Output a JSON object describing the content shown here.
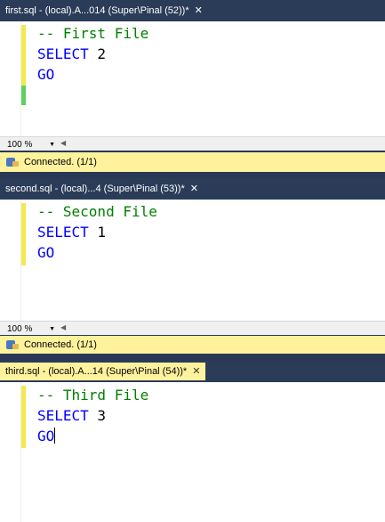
{
  "windows": [
    {
      "tab_title": "first.sql - (local).A...014 (Super\\Pinal (52))*",
      "close_glyph": "✕",
      "active": false,
      "lines": [
        {
          "parts": [
            {
              "t": "-- First File",
              "c": "cmt"
            }
          ]
        },
        {
          "parts": [
            {
              "t": "SELECT",
              "c": "kw"
            },
            {
              "t": " 2",
              "c": "num"
            }
          ]
        },
        {
          "parts": [
            {
              "t": "GO",
              "c": "kw"
            }
          ]
        }
      ],
      "zoom": "100 %",
      "status": "Connected. (1/1)"
    },
    {
      "tab_title": "second.sql - (local)...4 (Super\\Pinal (53))*",
      "close_glyph": "✕",
      "active": false,
      "lines": [
        {
          "parts": [
            {
              "t": "-- Second File",
              "c": "cmt"
            }
          ]
        },
        {
          "parts": [
            {
              "t": "SELECT",
              "c": "kw"
            },
            {
              "t": " 1",
              "c": "num"
            }
          ]
        },
        {
          "parts": [
            {
              "t": "GO",
              "c": "kw"
            }
          ]
        }
      ],
      "zoom": "100 %",
      "status": "Connected. (1/1)"
    },
    {
      "tab_title": "third.sql - (local).A...14 (Super\\Pinal (54))*",
      "close_glyph": "✕",
      "active": true,
      "lines": [
        {
          "parts": [
            {
              "t": "-- Third File",
              "c": "cmt"
            }
          ]
        },
        {
          "parts": [
            {
              "t": "SELECT",
              "c": "kw"
            },
            {
              "t": " 3",
              "c": "num"
            }
          ]
        },
        {
          "parts": [
            {
              "t": "GO",
              "c": "kw"
            }
          ]
        }
      ]
    }
  ],
  "colors": {
    "chrome": "#293955",
    "active_tab": "#fff29d",
    "status_bar": "#fff29d",
    "comment": "#008000",
    "keyword": "#0000ff",
    "change_bar_unsaved": "#f4e94c",
    "change_bar_saved": "#5fcf5f"
  }
}
